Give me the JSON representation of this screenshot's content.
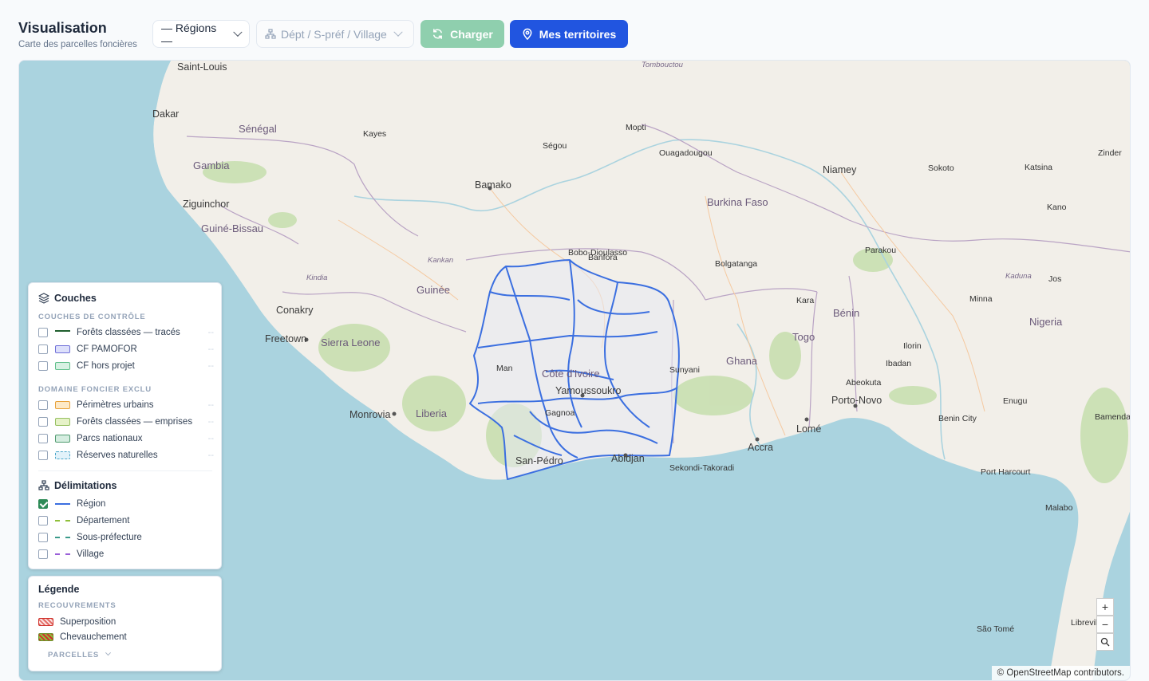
{
  "header": {
    "title": "Visualisation",
    "subtitle": "Carte des parcelles foncières",
    "region_select": "— Régions —",
    "dept_select": "Dépt / S-préf / Village",
    "load_button": "Charger",
    "territories_button": "Mes territoires"
  },
  "colors": {
    "primary": "#2155e0",
    "load": "#8fcfae",
    "region_line": "#3b6fe0",
    "ocean": "#aad3df",
    "land": "#f2efe9"
  },
  "layers": {
    "title": "Couches",
    "control_section": "COUCHES DE CONTRÔLE",
    "control": [
      {
        "label": "Forêts classées — tracés",
        "count": "--"
      },
      {
        "label": "CF PAMOFOR",
        "count": "--"
      },
      {
        "label": "CF hors projet",
        "count": "--"
      }
    ],
    "excluded_section": "DOMAINE FONCIER EXCLU",
    "excluded": [
      {
        "label": "Périmètres urbains",
        "count": "--"
      },
      {
        "label": "Forêts classées — emprises",
        "count": "--"
      },
      {
        "label": "Parcs nationaux",
        "count": "--"
      },
      {
        "label": "Réserves naturelles",
        "count": "--"
      }
    ],
    "delim_title": "Délimitations",
    "delimitations": [
      {
        "label": "Région",
        "checked": true
      },
      {
        "label": "Département",
        "checked": false
      },
      {
        "label": "Sous-préfecture",
        "checked": false
      },
      {
        "label": "Village",
        "checked": false
      }
    ]
  },
  "legend": {
    "title": "Légende",
    "section": "RECOUVREMENTS",
    "items": [
      "Superposition",
      "Chevauchement"
    ],
    "parcels": "PARCELLES"
  },
  "map": {
    "attribution": "© OpenStreetMap contributors.",
    "labels": [
      {
        "t": "Saint-Louis",
        "c": "big"
      },
      {
        "t": "Dakar",
        "c": "big"
      },
      {
        "t": "Sénégal",
        "c": "country"
      },
      {
        "t": "Gambia",
        "c": "country"
      },
      {
        "t": "Ziguinchor",
        "c": "big"
      },
      {
        "t": "Guiné-Bissau",
        "c": "country"
      },
      {
        "t": "Conakry",
        "c": "big"
      },
      {
        "t": "Freetown",
        "c": "big"
      },
      {
        "t": "Sierra Leone",
        "c": "country"
      },
      {
        "t": "Guinée",
        "c": "country"
      },
      {
        "t": "Monrovia",
        "c": "big"
      },
      {
        "t": "Liberia",
        "c": "country"
      },
      {
        "t": "Bamako",
        "c": "big"
      },
      {
        "t": "Ségou",
        "c": ""
      },
      {
        "t": "Mopti",
        "c": ""
      },
      {
        "t": "Burkina Faso",
        "c": "country"
      },
      {
        "t": "Niamey",
        "c": "big"
      },
      {
        "t": "Bobo-Dioulasso",
        "c": ""
      },
      {
        "t": "Banfora",
        "c": ""
      },
      {
        "t": "Côte d'Ivoire",
        "c": "country"
      },
      {
        "t": "Yamoussoukro",
        "c": "big"
      },
      {
        "t": "Abidjan",
        "c": "big"
      },
      {
        "t": "San-Pédro",
        "c": "big"
      },
      {
        "t": "Ghana",
        "c": "country"
      },
      {
        "t": "Sunyani",
        "c": ""
      },
      {
        "t": "Sekondi-Takoradi",
        "c": ""
      },
      {
        "t": "Accra",
        "c": "big"
      },
      {
        "t": "Lomé",
        "c": "big"
      },
      {
        "t": "Togo",
        "c": "country"
      },
      {
        "t": "Bénin",
        "c": "country"
      },
      {
        "t": "Porto-Novo",
        "c": "big"
      },
      {
        "t": "Nigeria",
        "c": "country"
      },
      {
        "t": "Ibadan",
        "c": ""
      },
      {
        "t": "Ilorin",
        "c": ""
      },
      {
        "t": "Kano",
        "c": ""
      },
      {
        "t": "Sokoto",
        "c": ""
      },
      {
        "t": "Port Harcourt",
        "c": ""
      },
      {
        "t": "Malabo",
        "c": ""
      },
      {
        "t": "São Tomé",
        "c": ""
      },
      {
        "t": "Libreville",
        "c": ""
      },
      {
        "t": "Jos",
        "c": ""
      },
      {
        "t": "Minna",
        "c": ""
      },
      {
        "t": "Kaduna",
        "c": "it"
      },
      {
        "t": "Katsina",
        "c": ""
      },
      {
        "t": "Zinder",
        "c": ""
      },
      {
        "t": "Tombouctou",
        "c": "it"
      },
      {
        "t": "Kayes",
        "c": ""
      },
      {
        "t": "Kindia",
        "c": "it"
      },
      {
        "t": "Kankan",
        "c": "it"
      },
      {
        "t": "Man",
        "c": ""
      },
      {
        "t": "Gagnoa",
        "c": ""
      },
      {
        "t": "Bolgatanga",
        "c": ""
      },
      {
        "t": "Ouagadougou",
        "c": ""
      },
      {
        "t": "Kara",
        "c": ""
      },
      {
        "t": "Parakou",
        "c": ""
      },
      {
        "t": "Abeokuta",
        "c": ""
      },
      {
        "t": "Benin City",
        "c": ""
      },
      {
        "t": "Enugu",
        "c": ""
      },
      {
        "t": "Bamenda",
        "c": ""
      }
    ]
  }
}
